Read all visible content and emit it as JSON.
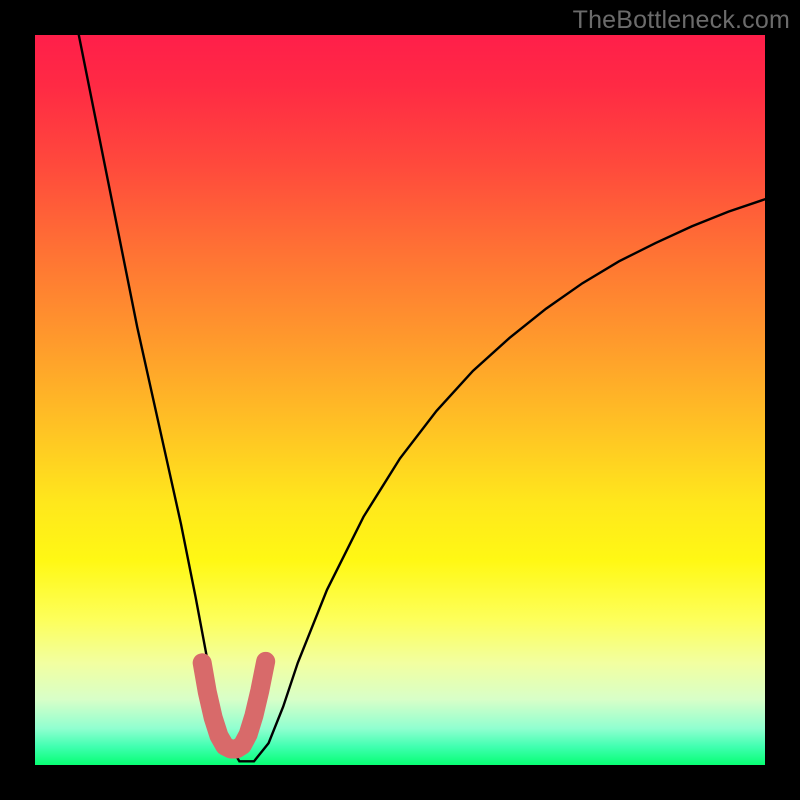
{
  "watermark": "TheBottleneck.com",
  "chart_data": {
    "type": "line",
    "title": "",
    "xlabel": "",
    "ylabel": "",
    "xlim": [
      0,
      100
    ],
    "ylim": [
      0,
      100
    ],
    "series": [
      {
        "name": "bottleneck-curve",
        "x": [
          6,
          8,
          10,
          12,
          14,
          16,
          18,
          20,
          22,
          23.5,
          25,
          26.5,
          28,
          30,
          32,
          34,
          36,
          40,
          45,
          50,
          55,
          60,
          65,
          70,
          75,
          80,
          85,
          90,
          95,
          100
        ],
        "y": [
          100,
          90,
          80,
          70,
          60,
          51,
          42,
          33,
          23,
          15,
          8,
          3,
          0.5,
          0.5,
          3,
          8,
          14,
          24,
          34,
          42,
          48.5,
          54,
          58.5,
          62.5,
          66,
          69,
          71.5,
          73.8,
          75.8,
          77.5
        ]
      }
    ],
    "highlight": {
      "name": "valley-marker",
      "x": [
        22.9,
        23.6,
        24.4,
        25.2,
        26.0,
        26.8,
        27.6,
        28.4,
        29.2,
        30.0,
        30.8,
        31.6
      ],
      "y": [
        14.0,
        10.0,
        6.5,
        4.0,
        2.6,
        2.2,
        2.2,
        2.7,
        4.2,
        6.8,
        10.2,
        14.2
      ]
    },
    "colors": {
      "curve": "#000000",
      "highlight": "#d86a6a",
      "frame": "#000000"
    }
  }
}
